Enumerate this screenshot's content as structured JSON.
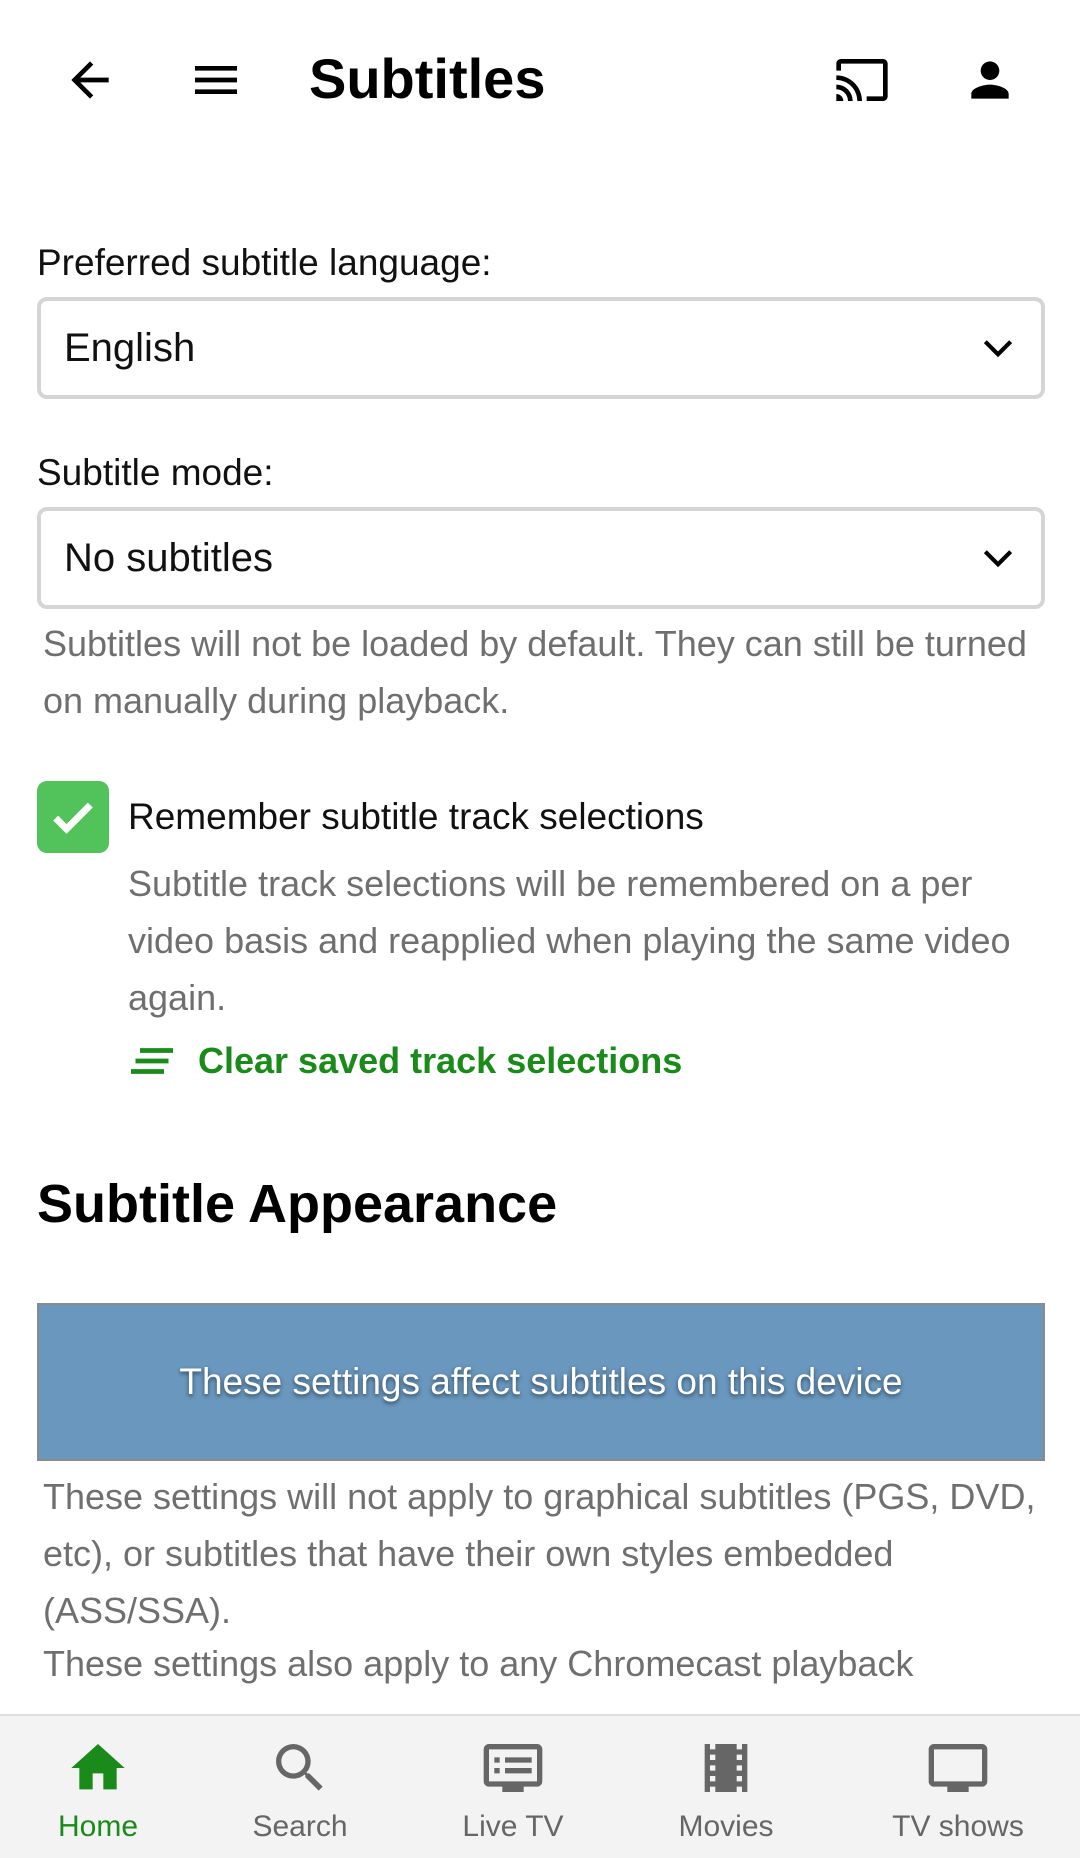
{
  "header": {
    "title": "Subtitles",
    "icons": [
      "back-arrow-icon",
      "menu-icon",
      "cast-icon",
      "account-icon"
    ]
  },
  "language": {
    "label": "Preferred subtitle language:",
    "value": "English"
  },
  "mode": {
    "label": "Subtitle mode:",
    "value": "No subtitles",
    "help": "Subtitles will not be loaded by default. They can still be turned on manually during playback."
  },
  "remember": {
    "checked": true,
    "label": "Remember subtitle track selections",
    "description": "Subtitle track selections will be remembered on a per video basis and reapplied when playing the same video again.",
    "clear_label": "Clear saved track selections"
  },
  "appearance": {
    "title": "Subtitle Appearance",
    "banner": "These settings affect subtitles on this device",
    "note1": "These settings will not apply to graphical subtitles (PGS, DVD, etc), or subtitles that have their own styles embedded (ASS/SSA).",
    "note2": "These settings also apply to any Chromecast playback"
  },
  "nav": {
    "items": [
      {
        "label": "Home",
        "icon": "home-icon",
        "active": true
      },
      {
        "label": "Search",
        "icon": "search-icon",
        "active": false
      },
      {
        "label": "Live TV",
        "icon": "live-tv-icon",
        "active": false
      },
      {
        "label": "Movies",
        "icon": "movies-icon",
        "active": false
      },
      {
        "label": "TV shows",
        "icon": "tv-icon",
        "active": false
      }
    ]
  },
  "colors": {
    "accent": "#1a8a1a",
    "checkbox": "#52c25a",
    "banner": "#6997bd"
  }
}
